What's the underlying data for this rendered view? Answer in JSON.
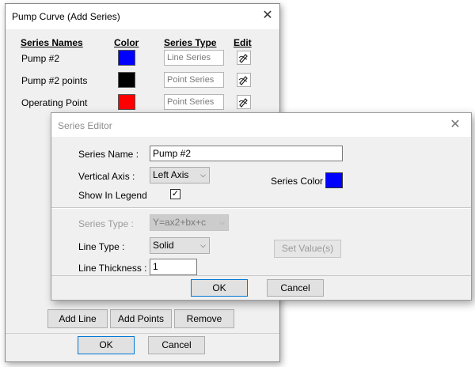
{
  "outer_dialog": {
    "title": "Pump Curve (Add Series)",
    "headers": {
      "series_names": "Series Names",
      "color": "Color",
      "series_type": "Series Type",
      "edit": "Edit"
    },
    "rows": [
      {
        "name": "Pump #2",
        "color": "#0000ff",
        "type": "Line Series",
        "edit_icon": "edit-pencil-icon"
      },
      {
        "name": "Pump #2 points",
        "color": "#000000",
        "type": "Point Series",
        "edit_icon": "edit-pencil-icon"
      },
      {
        "name": "Operating Point",
        "color": "#ff0000",
        "type": "Point Series",
        "edit_icon": "edit-pencil-icon"
      }
    ],
    "buttons": {
      "add_line": "Add Line",
      "add_points": "Add Points",
      "remove": "Remove",
      "ok": "OK",
      "cancel": "Cancel"
    },
    "close_icon": "close-icon"
  },
  "series_editor": {
    "title": "Series Editor",
    "series_name_label": "Series Name :",
    "series_name_value": "Pump #2",
    "vertical_axis_label": "Vertical Axis :",
    "vertical_axis_value": "Left Axis",
    "show_in_legend_label": "Show In Legend",
    "show_in_legend_checked": true,
    "series_color_label": "Series Color :",
    "series_color": "#0000ff",
    "series_type_label": "Series Type :",
    "series_type_value": "Y=ax2+bx+c",
    "line_type_label": "Line Type :",
    "line_type_value": "Solid",
    "line_thickness_label": "Line Thickness :",
    "line_thickness_value": "1",
    "set_values_button": "Set Value(s)",
    "ok_button": "OK",
    "cancel_button": "Cancel",
    "close_icon": "close-icon"
  }
}
